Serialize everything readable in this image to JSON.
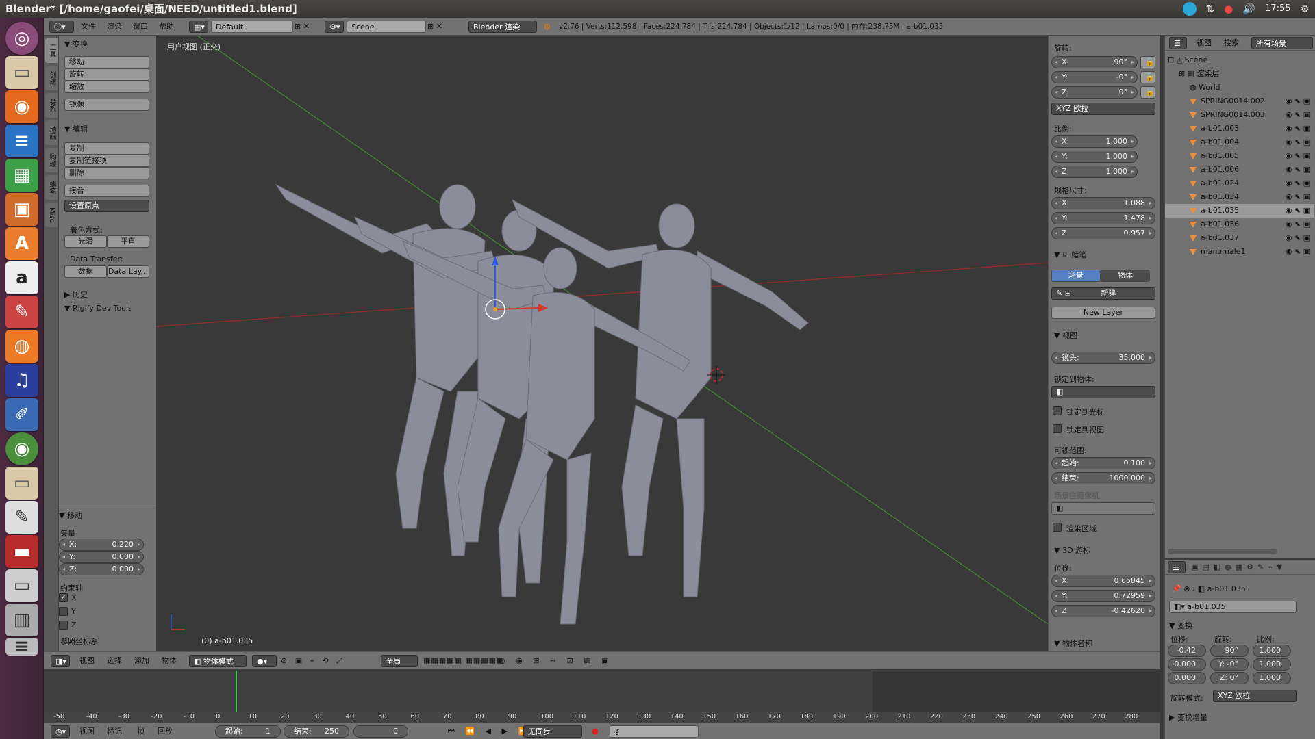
{
  "os": {
    "title": "Blender* [/home/gaofei/桌面/NEED/untitled1.blend]",
    "time": "17:55"
  },
  "menu": {
    "file": "文件",
    "render": "渲染",
    "window": "窗口",
    "help": "帮助",
    "layout": "Default",
    "scene": "Scene",
    "engine": "Blender 渲染",
    "stats": "v2.76 | Verts:112,598 | Faces:224,784 | Tris:224,784 | Objects:1/12 | Lamps:0/0 | 内存:238.75M | a-b01.035"
  },
  "tools": {
    "vtabs": [
      "工具",
      "创建",
      "关系",
      "动画",
      "物理",
      "蜡笔",
      "Misc"
    ],
    "transform_header": "变换",
    "move": "移动",
    "rotate": "旋转",
    "scale": "缩放",
    "mirror": "镜像",
    "edit_header": "编辑",
    "duplicate": "复制",
    "duplicate_linked": "复制链接项",
    "delete": "删除",
    "join": "接合",
    "set_origin": "设置原点",
    "shading_label": "着色方式:",
    "smooth": "光滑",
    "flat": "平直",
    "data_transfer_label": "Data Transfer:",
    "data": "数据",
    "data_layers": "Data Lay...",
    "history_header": "历史",
    "rigify_header": "Rigify Dev Tools"
  },
  "operator": {
    "header": "移动",
    "vector_label": "矢量",
    "x": "X:",
    "x_val": "0.220",
    "y": "Y:",
    "y_val": "0.000",
    "z": "Z:",
    "z_val": "0.000",
    "constraint_label": "约束轴",
    "cx": "X",
    "cy": "Y",
    "cz": "Z",
    "orient": "参照坐标系"
  },
  "viewport": {
    "view_label": "用户视图  (正交)",
    "object_label": "(0) a-b01.035"
  },
  "props": {
    "rotation_label": "旋转:",
    "rx": "X:",
    "rx_val": "90°",
    "ry": "Y:",
    "ry_val": "-0°",
    "rz": "Z:",
    "rz_val": "0°",
    "rot_mode": "XYZ 欧拉",
    "scale_label": "比例:",
    "sx_val": "1.000",
    "sy_val": "1.000",
    "sz_val": "1.000",
    "dim_label": "规格尺寸:",
    "dx_val": "1.088",
    "dy_val": "1.478",
    "dz_val": "0.957",
    "gp_header": "蜡笔",
    "gp_scene": "场景",
    "gp_object": "物体",
    "gp_new": "新建",
    "gp_new_layer": "New Layer",
    "view_header": "视图",
    "lens": "镜头:",
    "lens_val": "35.000",
    "lock_obj": "锁定到物体:",
    "lock_cursor": "锁定到光标",
    "lock_view": "锁定到视图",
    "clip_label": "可视范围:",
    "clip_start": "起始:",
    "clip_start_val": "0.100",
    "clip_end": "结束:",
    "clip_end_val": "1000.000",
    "scene_cam": "场景主摄像机",
    "render_border": "渲染区域",
    "cursor_header": "3D 游标",
    "loc_label": "位移:",
    "cx_val": "0.65845",
    "cy_val": "0.72959",
    "cz_val": "-0.42620",
    "objname_header": "物体名称"
  },
  "outliner": {
    "view": "视图",
    "search": "搜索",
    "all_scenes": "所有场景",
    "scene": "Scene",
    "render_layers": "渲染层",
    "world": "World",
    "objects": [
      "SPRING0014.002",
      "SPRING0014.003",
      "a-b01.003",
      "a-b01.004",
      "a-b01.005",
      "a-b01.006",
      "a-b01.024",
      "a-b01.034",
      "a-b01.035",
      "a-b01.036",
      "a-b01.037",
      "manomale1"
    ]
  },
  "objprops": {
    "name": "a-b01.035",
    "name2": "a-b01.035",
    "header": "变换",
    "loc": "位移:",
    "rot": "旋转:",
    "scl": "比例:",
    "lx": "-0.42",
    "ly": "0.000",
    "lz": "0.000",
    "rx": "90°",
    "ry": "Y: -0°",
    "rz": "Z: 0°",
    "sx": "1.000",
    "sy": "1.000",
    "sz": "1.000",
    "rot_mode_label": "旋转模式:",
    "rot_mode": "XYZ 欧拉",
    "delta": "变换增量"
  },
  "vtoolbar": {
    "view": "视图",
    "select": "选择",
    "add": "添加",
    "object": "物体",
    "mode": "物体模式",
    "global": "全局"
  },
  "timeline": {
    "ticks": [
      "-50",
      "-40",
      "-30",
      "-20",
      "-10",
      "0",
      "10",
      "20",
      "30",
      "40",
      "50",
      "60",
      "70",
      "80",
      "90",
      "100",
      "110",
      "120",
      "130",
      "140",
      "150",
      "160",
      "170",
      "180",
      "190",
      "200",
      "210",
      "220",
      "230",
      "240",
      "250",
      "260",
      "270",
      "280"
    ],
    "view": "视图",
    "marker": "标记",
    "frame": "帧",
    "playback": "回放",
    "start": "起始:",
    "start_val": "1",
    "end": "结束:",
    "end_val": "250",
    "current": "0",
    "sync": "无同步"
  }
}
